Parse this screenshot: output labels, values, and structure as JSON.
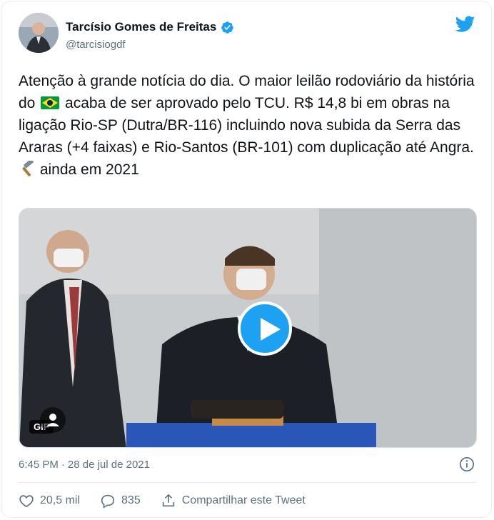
{
  "author": {
    "name": "Tarcísio Gomes de Freitas",
    "handle": "@tarcisiogdf"
  },
  "tweet": {
    "text_part1": "Atenção à grande notícia do dia. O maior leilão rodoviário da história do ",
    "text_part2": " acaba de ser aprovado pelo TCU. R$ 14,8 bi em obras na ligação Rio-SP (Dutra/BR-116) incluindo nova subida da Serra das Araras (+4 faixas) e Rio-Santos (BR-101) com duplicação até Angra. ",
    "text_part3": " ainda em 2021"
  },
  "media": {
    "badge": "GIF"
  },
  "meta": {
    "time": "6:45 PM",
    "separator": "·",
    "date": "28 de jul de 2021"
  },
  "actions": {
    "likes": "20,5 mil",
    "replies": "835",
    "share": "Compartilhar este Tweet"
  },
  "colors": {
    "brand": "#1da1f2",
    "text": "#0f1419",
    "secondary": "#5b7083"
  },
  "icons": [
    "verified-icon",
    "twitter-bird-icon",
    "brazil-flag-icon",
    "hammer-icon",
    "play-icon",
    "info-icon",
    "heart-icon",
    "reply-icon",
    "share-icon"
  ]
}
